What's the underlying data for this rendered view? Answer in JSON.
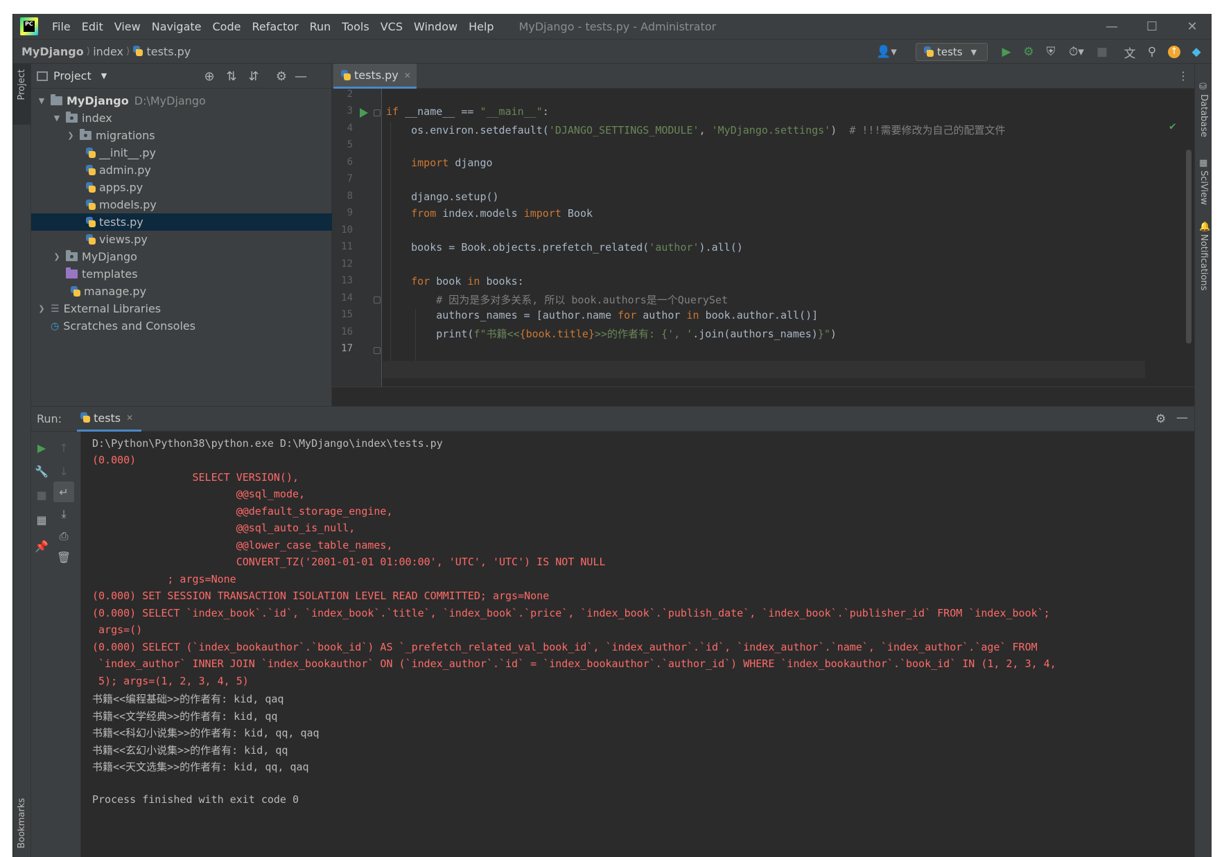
{
  "window": {
    "title": "MyDjango - tests.py - Administrator",
    "menu": [
      "File",
      "Edit",
      "View",
      "Navigate",
      "Code",
      "Refactor",
      "Run",
      "Tools",
      "VCS",
      "Window",
      "Help"
    ],
    "logo_text": "PC"
  },
  "breadcrumb": {
    "project": "MyDjango",
    "folder": "index",
    "file": "tests.py"
  },
  "toolbar": {
    "run_config": "tests"
  },
  "project_panel": {
    "title": "Project",
    "tree": [
      {
        "label": "MyDjango",
        "path": "D:\\MyDjango",
        "type": "folder",
        "expanded": true
      },
      {
        "label": "index",
        "type": "pkg",
        "expanded": true
      },
      {
        "label": "migrations",
        "type": "pkg",
        "expanded": false
      },
      {
        "label": "__init__.py",
        "type": "py"
      },
      {
        "label": "admin.py",
        "type": "py"
      },
      {
        "label": "apps.py",
        "type": "py"
      },
      {
        "label": "models.py",
        "type": "py"
      },
      {
        "label": "tests.py",
        "type": "py",
        "selected": true
      },
      {
        "label": "views.py",
        "type": "py"
      },
      {
        "label": "MyDjango",
        "type": "pkg",
        "expanded": false
      },
      {
        "label": "templates",
        "type": "folder-purple"
      },
      {
        "label": "manage.py",
        "type": "py"
      },
      {
        "label": "External Libraries",
        "type": "lib",
        "expanded": false
      },
      {
        "label": "Scratches and Consoles",
        "type": "scratch"
      }
    ]
  },
  "editor": {
    "tab": "tests.py",
    "line_numbers": [
      "2",
      "3",
      "4",
      "5",
      "6",
      "7",
      "8",
      "9",
      "10",
      "11",
      "12",
      "13",
      "14",
      "15",
      "16",
      "17"
    ],
    "lines": {
      "l3_if": "if",
      "l3_name": " __name__ == ",
      "l3_str": "\"__main__\"",
      "l3_end": ":",
      "l4_a": "    os.environ.setdefault(",
      "l4_s1": "'DJANGO_SETTINGS_MODULE'",
      "l4_b": ", ",
      "l4_s2": "'MyDjango.settings'",
      "l4_c": ")  ",
      "l4_cmt": "# !!!需要修改为自己的配置文件",
      "l6_kw": "    import",
      "l6_rest": " django",
      "l8": "    django.setup()",
      "l9_from": "    from",
      "l9_mid": " index.models ",
      "l9_imp": "import",
      "l9_end": " Book",
      "l11_a": "    books = Book.objects.prefetch_related(",
      "l11_s": "'author'",
      "l11_b": ").all()",
      "l13_for": "    for",
      "l13_a": " book ",
      "l13_in": "in",
      "l13_b": " books:",
      "l14_cmt": "        # 因为是多对多关系, 所以 book.authors是一个QuerySet",
      "l15_a": "        authors_names = [author.name ",
      "l15_for": "for",
      "l15_b": " author ",
      "l15_in": "in",
      "l15_c": " book.author.all()]",
      "l16_a": "        print(",
      "l16_s1": "f\"书籍<<",
      "l16_b": "{book.title}",
      "l16_s2": ">>的作者有: {",
      "l16_s3": "', '",
      "l16_c": ".join(authors_names)",
      "l16_s4": "}\"",
      "l16_d": ")"
    }
  },
  "right_stripe": [
    "Database",
    "SciView",
    "Notifications"
  ],
  "left_stripe": [
    "Project",
    "Bookmarks"
  ],
  "run_panel": {
    "label": "Run:",
    "tab": "tests",
    "output": [
      {
        "text": "D:\\Python\\Python38\\python.exe D:\\MyDjango\\index\\tests.py",
        "err": false
      },
      {
        "text": "(0.000)",
        "err": true
      },
      {
        "text": "                SELECT VERSION(),",
        "err": true
      },
      {
        "text": "                       @@sql_mode,",
        "err": true
      },
      {
        "text": "                       @@default_storage_engine,",
        "err": true
      },
      {
        "text": "                       @@sql_auto_is_null,",
        "err": true
      },
      {
        "text": "                       @@lower_case_table_names,",
        "err": true
      },
      {
        "text": "                       CONVERT_TZ('2001-01-01 01:00:00', 'UTC', 'UTC') IS NOT NULL",
        "err": true
      },
      {
        "text": "            ; args=None",
        "err": true
      },
      {
        "text": "(0.000) SET SESSION TRANSACTION ISOLATION LEVEL READ COMMITTED; args=None",
        "err": true
      },
      {
        "text": "(0.000) SELECT `index_book`.`id`, `index_book`.`title`, `index_book`.`price`, `index_book`.`publish_date`, `index_book`.`publisher_id` FROM `index_book`;",
        "err": true
      },
      {
        "text": " args=()",
        "err": true
      },
      {
        "text": "(0.000) SELECT (`index_bookauthor`.`book_id`) AS `_prefetch_related_val_book_id`, `index_author`.`id`, `index_author`.`name`, `index_author`.`age` FROM",
        "err": true
      },
      {
        "text": " `index_author` INNER JOIN `index_bookauthor` ON (`index_author`.`id` = `index_bookauthor`.`author_id`) WHERE `index_bookauthor`.`book_id` IN (1, 2, 3, 4,",
        "err": true
      },
      {
        "text": " 5); args=(1, 2, 3, 4, 5)",
        "err": true
      },
      {
        "text": "书籍<<编程基础>>的作者有: kid, qaq",
        "err": false
      },
      {
        "text": "书籍<<文学经典>>的作者有: kid, qq",
        "err": false
      },
      {
        "text": "书籍<<科幻小说集>>的作者有: kid, qq, qaq",
        "err": false
      },
      {
        "text": "书籍<<玄幻小说集>>的作者有: kid, qq",
        "err": false
      },
      {
        "text": "书籍<<天文选集>>的作者有: kid, qq, qaq",
        "err": false
      },
      {
        "text": "",
        "err": false
      },
      {
        "text": "Process finished with exit code 0",
        "err": false
      }
    ]
  },
  "colors": {
    "background": "#2b2b2b",
    "panel": "#3c3f41",
    "selection": "#0d293e",
    "keyword": "#cc7832",
    "string": "#6a8759",
    "comment": "#808080",
    "error_text": "#ff6b68",
    "run_green": "#499c54"
  }
}
